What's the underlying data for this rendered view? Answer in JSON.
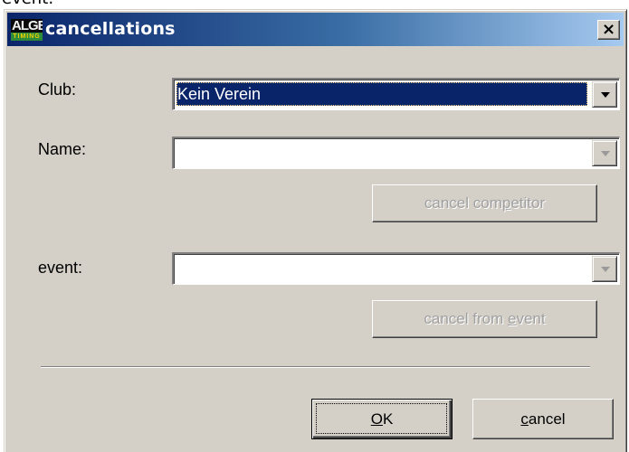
{
  "background_text": "event:",
  "window": {
    "title": "cancellations",
    "logo": {
      "top": "ALGE",
      "bottom": "TIMING"
    },
    "close_symbol": "×"
  },
  "form": {
    "club": {
      "label": "Club:",
      "value": "Kein Verein"
    },
    "name": {
      "label": "Name:",
      "value": ""
    },
    "cancel_competitor": {
      "pre": "cancel com",
      "hot": "p",
      "post": "etitor"
    },
    "event": {
      "label": "event:",
      "value": ""
    },
    "cancel_from_event": {
      "pre": "cancel from ",
      "hot": "e",
      "post": "vent"
    }
  },
  "buttons": {
    "ok": {
      "hot": "O",
      "post": "K"
    },
    "cancel": {
      "hot": "c",
      "post": "ancel"
    }
  },
  "colors": {
    "titlebar_start": "#0a246a",
    "titlebar_end": "#a6caf0",
    "dialog_bg": "#d4d0c8",
    "selection": "#0a246a"
  }
}
